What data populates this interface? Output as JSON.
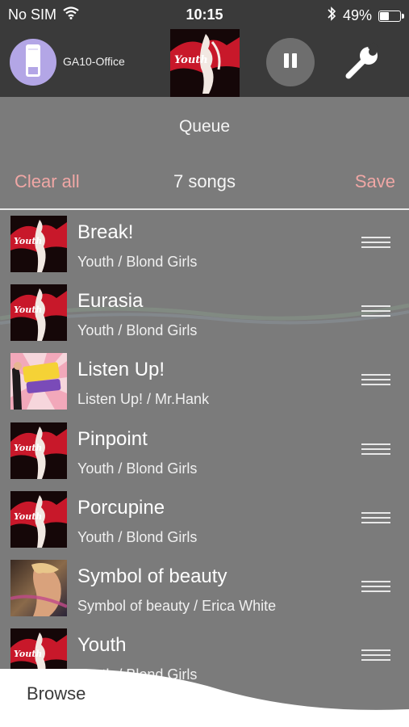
{
  "status": {
    "carrier": "No SIM",
    "time": "10:15",
    "battery_text": "49%",
    "battery_level": 0.49
  },
  "player": {
    "device_name": "GA10-Office",
    "now_playing_art": "Youth album art",
    "art_script_text": "Youth"
  },
  "queue": {
    "title": "Queue",
    "clear_label": "Clear all",
    "count_label": "7 songs",
    "save_label": "Save"
  },
  "songs": [
    {
      "title": "Break!",
      "subtitle": "Youth / Blond Girls",
      "art": "youth"
    },
    {
      "title": "Eurasia",
      "subtitle": "Youth / Blond Girls",
      "art": "youth"
    },
    {
      "title": "Listen Up!",
      "subtitle": "Listen Up! / Mr.Hank",
      "art": "listenup"
    },
    {
      "title": "Pinpoint",
      "subtitle": "Youth / Blond Girls",
      "art": "youth"
    },
    {
      "title": "Porcupine",
      "subtitle": "Youth / Blond Girls",
      "art": "youth"
    },
    {
      "title": "Symbol of beauty",
      "subtitle": "Symbol of beauty / Erica White",
      "art": "symbol"
    },
    {
      "title": "Youth",
      "subtitle": "Youth / Blond Girls",
      "art": "youth"
    }
  ],
  "browse": {
    "label": "Browse"
  },
  "colors": {
    "accent": "#f0a7a5",
    "bar": "#3a3a3a",
    "background": "#7b7b7b",
    "device": "#b3a6e6"
  }
}
